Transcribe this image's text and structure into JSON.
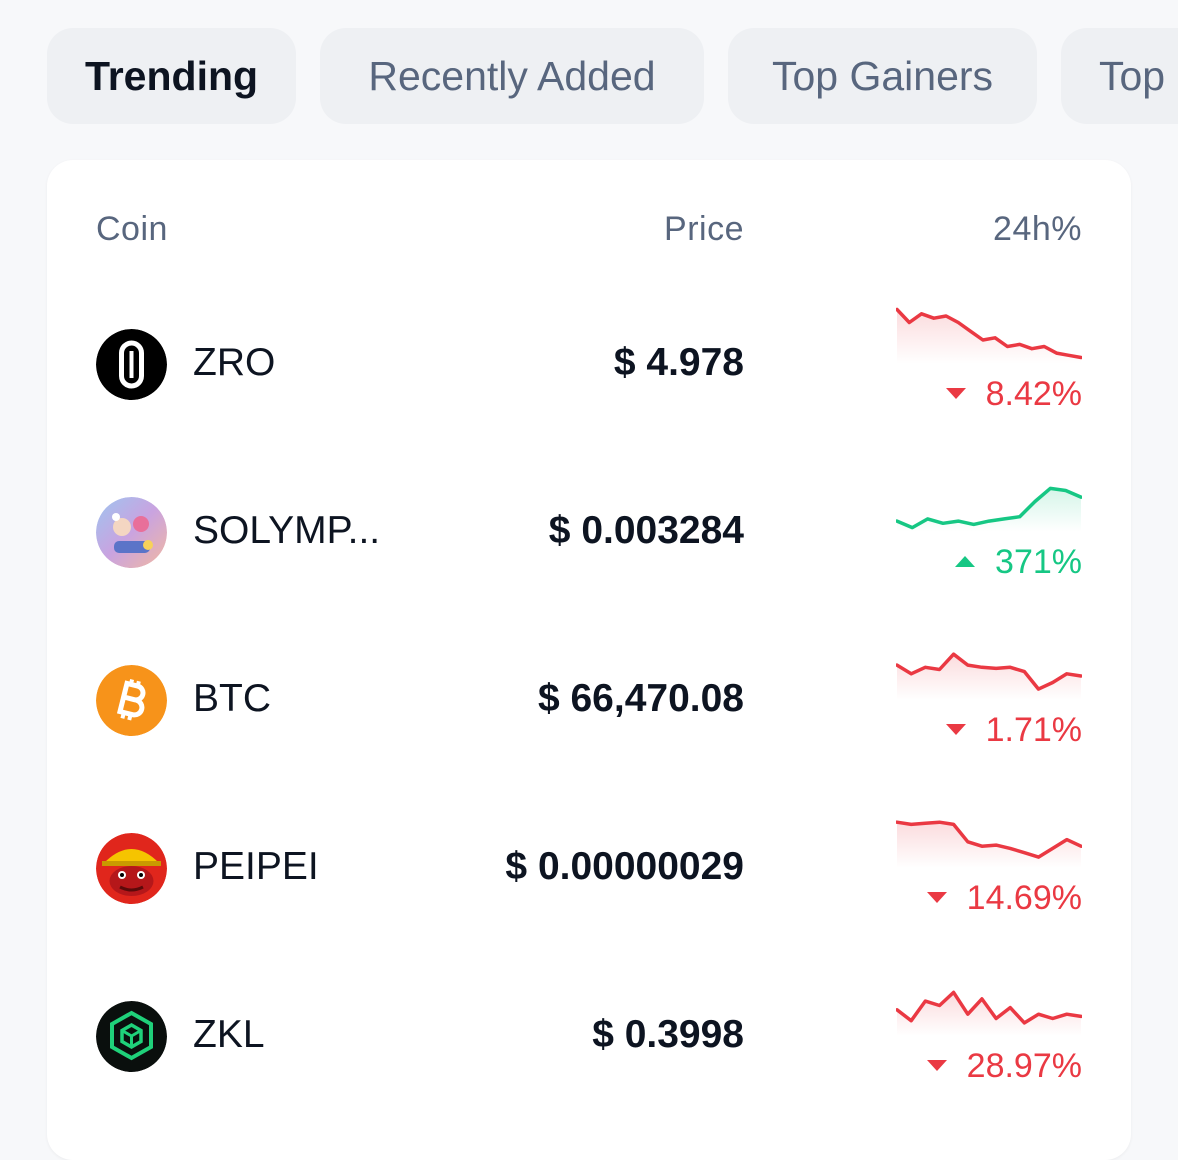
{
  "tabs": [
    {
      "label": "Trending",
      "active": true
    },
    {
      "label": "Recently Added",
      "active": false
    },
    {
      "label": "Top Gainers",
      "active": false
    },
    {
      "label": "Top",
      "active": false
    }
  ],
  "table": {
    "headers": {
      "coin": "Coin",
      "price": "Price",
      "change": "24h%"
    },
    "rows": [
      {
        "symbol": "ZRO",
        "icon": "layerzero-logo-icon",
        "price": "$ 4.978",
        "change": "8.42%",
        "direction": "down",
        "trend": [
          70,
          58,
          66,
          62,
          64,
          58,
          50,
          42,
          44,
          36,
          38,
          34,
          36,
          30,
          28,
          26
        ]
      },
      {
        "symbol": "SOLYMP...",
        "icon": "solymp-avatar-icon",
        "price": "$ 0.003284",
        "change": "371%",
        "direction": "up",
        "trend": [
          30,
          24,
          32,
          28,
          30,
          27,
          30,
          32,
          34,
          48,
          60,
          58,
          52
        ]
      },
      {
        "symbol": "BTC",
        "icon": "bitcoin-icon",
        "price": "$ 66,470.08",
        "change": "1.71%",
        "direction": "down",
        "trend": [
          52,
          44,
          50,
          48,
          62,
          52,
          50,
          49,
          50,
          46,
          30,
          36,
          44,
          42
        ]
      },
      {
        "symbol": "PEIPEI",
        "icon": "peipei-frog-icon",
        "price": "$ 0.00000029",
        "change": "14.69%",
        "direction": "down",
        "trend": [
          62,
          60,
          61,
          62,
          60,
          44,
          40,
          41,
          38,
          34,
          30,
          38,
          46,
          40
        ]
      },
      {
        "symbol": "ZKL",
        "icon": "zklink-logo-icon",
        "price": "$ 0.3998",
        "change": "28.97%",
        "direction": "down",
        "trend": [
          44,
          34,
          52,
          48,
          60,
          40,
          54,
          36,
          46,
          32,
          40,
          36,
          40,
          38
        ]
      }
    ]
  },
  "colors": {
    "down": "#ea3943",
    "up": "#16c784",
    "text": "#0d1421",
    "muted": "#58667e"
  }
}
